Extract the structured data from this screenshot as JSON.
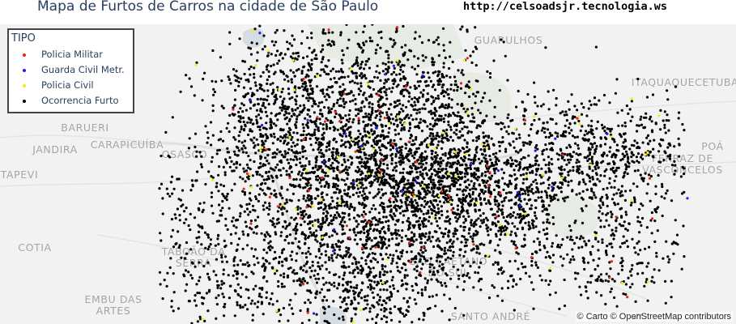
{
  "header": {
    "title": "Mapa de Furtos de Carros na cidade de São Paulo",
    "url": "http://celsoadsjr.tecnologia.ws"
  },
  "legend": {
    "title": "TIPO",
    "items": [
      {
        "label": "Policia Militar",
        "color": "#e8261e"
      },
      {
        "label": "Guarda Civil Metr.",
        "color": "#1e1eea"
      },
      {
        "label": "Policia Civil",
        "color": "#f7ec11"
      },
      {
        "label": "Ocorrencia Furto",
        "color": "#000000"
      }
    ]
  },
  "places": [
    "GUARULHOS",
    "ITAQUAQUECETUBA",
    "BARUERI",
    "JANDIRA",
    "CARAPICUÍBA",
    "OSASCO",
    "FERRAZ DE\nVASCONCELOS",
    "POÁ",
    "TAPEVI",
    "COTIA",
    "TABOÃO DA\nSERRA",
    "SÃO CAETANO\nDO SUL",
    "EMBU DAS\nARTES",
    "SANTO ANDRÉ"
  ],
  "attribution": "© Carto © OpenStreetMap contributors",
  "colors": {
    "land": "#f2f2f2",
    "water": "#d6dde2",
    "park": "#e6ebe3"
  }
}
